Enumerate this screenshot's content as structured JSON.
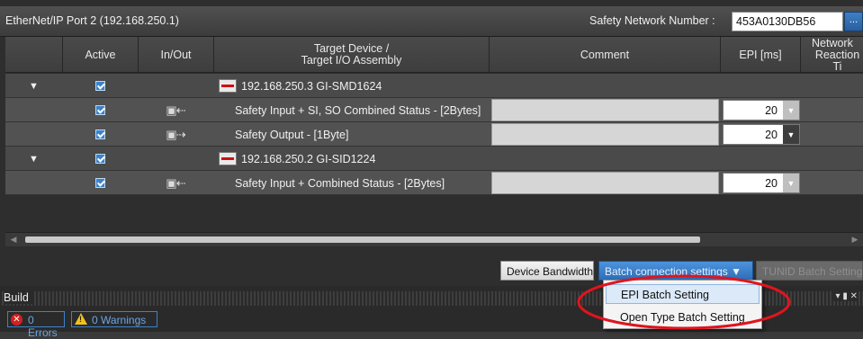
{
  "header": {
    "port_title": "EtherNet/IP Port 2 (192.168.250.1)",
    "snn_label": "Safety Network Number :",
    "snn_value": "453A0130DB56",
    "snn_button": "..."
  },
  "columns": {
    "active": "Active",
    "inout": "In/Out",
    "target_line1": "Target Device /",
    "target_line2": "Target I/O Assembly",
    "comment": "Comment",
    "epi": "EPI [ms]",
    "reaction_line1": "Network",
    "reaction_line2": "Reaction Ti"
  },
  "rows": [
    {
      "kind": "device",
      "expander": "▼",
      "active": true,
      "target": "192.168.250.3 GI-SMD1624"
    },
    {
      "kind": "io",
      "active": true,
      "inout_icon": "input-icon",
      "target": "Safety Input + SI, SO Combined Status - [2Bytes]",
      "epi": "20",
      "epi_dropdown": "disabled"
    },
    {
      "kind": "io",
      "active": true,
      "inout_icon": "output-icon",
      "target": "Safety Output - [1Byte]",
      "epi": "20",
      "epi_dropdown": "enabled"
    },
    {
      "kind": "device",
      "expander": "▼",
      "active": true,
      "target": "192.168.250.2 GI-SID1224"
    },
    {
      "kind": "io",
      "active": true,
      "inout_icon": "input-icon",
      "target": "Safety Input + Combined Status - [2Bytes]",
      "epi": "20",
      "epi_dropdown": "disabled"
    }
  ],
  "buttons": {
    "device_bandwidth": "Device Bandwidth",
    "batch_connection": "Batch connection settings ▼",
    "tunid_batch": "TUNID Batch Setting"
  },
  "menu": {
    "items": [
      "EPI Batch Setting",
      "Open Type Batch Setting"
    ]
  },
  "build": {
    "title": "Build",
    "errors": "0  Errors",
    "warnings": "0  Warnings"
  },
  "colors": {
    "accent": "#3d82c9",
    "highlight_ellipse": "#e0141e"
  }
}
